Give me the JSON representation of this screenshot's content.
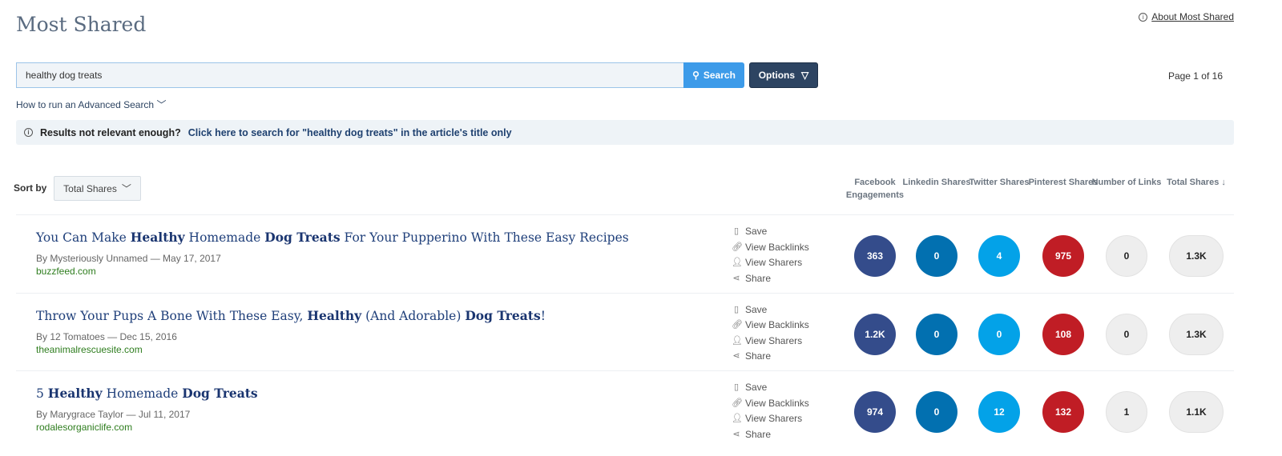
{
  "header": {
    "title": "Most Shared",
    "about_label": "About Most Shared"
  },
  "search": {
    "value": "healthy dog treats",
    "button_label": "Search",
    "options_label": "Options",
    "page_info": "Page 1 of 16",
    "advanced_label": "How to run an Advanced Search"
  },
  "banner": {
    "prefix": "Results not relevant enough?",
    "link": "Click here to search for \"healthy dog treats\" in the article's title only"
  },
  "sort": {
    "label": "Sort by",
    "value": "Total Shares"
  },
  "columns": [
    "Facebook Engagements",
    "Linkedin Shares",
    "Twitter Shares",
    "Pinterest Shares",
    "Number of Links",
    "Total Shares ↓"
  ],
  "actions": [
    "Save",
    "View Backlinks",
    "View Sharers",
    "Share"
  ],
  "colors": {
    "facebook": "#344c8b",
    "linkedin": "#0270b0",
    "twitter": "#03a2e8",
    "pinterest": "#c01d25",
    "search": "#3d9be9",
    "options": "#2d4462"
  },
  "articles": [
    {
      "title": [
        [
          "You Can Make ",
          0
        ],
        [
          "Healthy",
          1
        ],
        [
          " Homemade ",
          0
        ],
        [
          "Dog Treats",
          1
        ],
        [
          " For Your Pupperino With These Easy Recipes",
          0
        ]
      ],
      "meta": "By Mysteriously Unnamed — May 17, 2017",
      "domain": "buzzfeed.com",
      "facebook": "363",
      "linkedin": "0",
      "twitter": "4",
      "pinterest": "975",
      "links": "0",
      "total": "1.3K"
    },
    {
      "title": [
        [
          "Throw Your Pups A Bone With These Easy, ",
          0
        ],
        [
          "Healthy",
          1
        ],
        [
          " (And Adorable) ",
          0
        ],
        [
          "Dog Treats",
          1
        ],
        [
          "!",
          0
        ]
      ],
      "meta": "By 12 Tomatoes — Dec 15, 2016",
      "domain": "theanimalrescuesite.com",
      "facebook": "1.2K",
      "linkedin": "0",
      "twitter": "0",
      "pinterest": "108",
      "links": "0",
      "total": "1.3K"
    },
    {
      "title": [
        [
          "5 ",
          0
        ],
        [
          "Healthy",
          1
        ],
        [
          " Homemade ",
          0
        ],
        [
          "Dog Treats",
          1
        ]
      ],
      "meta": "By Marygrace Taylor — Jul 11, 2017",
      "domain": "rodalesorganiclife.com",
      "facebook": "974",
      "linkedin": "0",
      "twitter": "12",
      "pinterest": "132",
      "links": "1",
      "total": "1.1K"
    }
  ]
}
